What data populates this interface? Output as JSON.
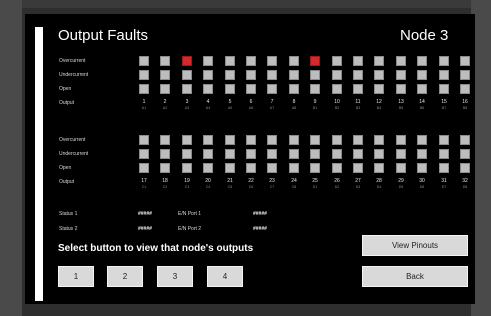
{
  "header": {
    "title": "Output Faults",
    "node": "Node 3"
  },
  "row_labels": [
    "Overcurrent",
    "Undercurrent",
    "Open",
    "Output"
  ],
  "bank1": {
    "outputs": [
      "1",
      "2",
      "3",
      "4",
      "5",
      "6",
      "7",
      "8",
      "9",
      "10",
      "11",
      "12",
      "13",
      "14",
      "15",
      "16"
    ],
    "subs": [
      "A1",
      "A2",
      "A3",
      "A4",
      "A5",
      "A6",
      "A7",
      "A8",
      "B1",
      "B2",
      "B3",
      "B4",
      "B5",
      "B6",
      "B7",
      "B8"
    ],
    "faults": [
      [
        false,
        false,
        true,
        false,
        false,
        false,
        false,
        false,
        true,
        false,
        false,
        false,
        false,
        false,
        false,
        false
      ],
      [
        false,
        false,
        false,
        false,
        false,
        false,
        false,
        false,
        false,
        false,
        false,
        false,
        false,
        false,
        false,
        false
      ],
      [
        false,
        false,
        false,
        false,
        false,
        false,
        false,
        false,
        false,
        false,
        false,
        false,
        false,
        false,
        false,
        false
      ]
    ]
  },
  "bank2": {
    "outputs": [
      "17",
      "18",
      "19",
      "20",
      "21",
      "22",
      "23",
      "24",
      "25",
      "26",
      "27",
      "28",
      "29",
      "30",
      "31",
      "32"
    ],
    "subs": [
      "C1",
      "C2",
      "C3",
      "C4",
      "C5",
      "C6",
      "C7",
      "C8",
      "D1",
      "D2",
      "D3",
      "D4",
      "D5",
      "D6",
      "D7",
      "D8"
    ],
    "faults": [
      [
        false,
        false,
        false,
        false,
        false,
        false,
        false,
        false,
        false,
        false,
        false,
        false,
        false,
        false,
        false,
        false
      ],
      [
        false,
        false,
        false,
        false,
        false,
        false,
        false,
        false,
        false,
        false,
        false,
        false,
        false,
        false,
        false,
        false
      ],
      [
        false,
        false,
        false,
        false,
        false,
        false,
        false,
        false,
        false,
        false,
        false,
        false,
        false,
        false,
        false,
        false
      ]
    ]
  },
  "status": {
    "status1_label": "Status 1",
    "status1_value": "#####",
    "status2_label": "Status 2",
    "status2_value": "#####",
    "port1_label": "E/N Port 1",
    "port1_value": "#####",
    "port2_label": "E/N Port 2",
    "port2_value": "#####"
  },
  "prompt": "Select button to view that node's outputs",
  "node_buttons": [
    "1",
    "2",
    "3",
    "4"
  ],
  "view_pinouts": "View Pinouts",
  "back": "Back",
  "colors": {
    "fault": "#d42a2a",
    "ok": "#bdbdbd",
    "screen": "#000000"
  }
}
